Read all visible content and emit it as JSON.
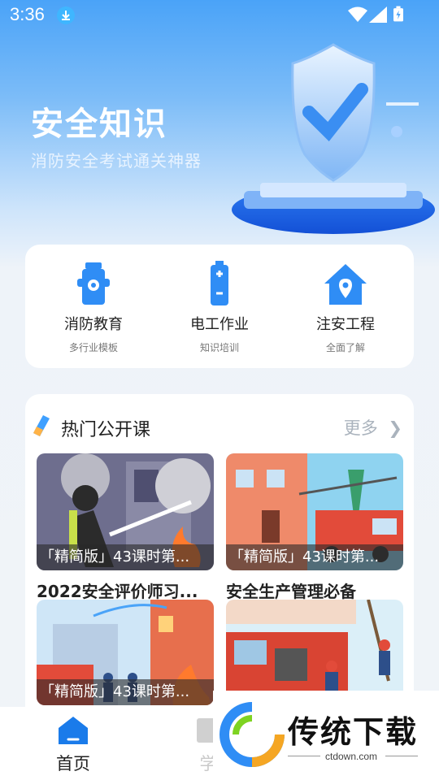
{
  "status_bar": {
    "time": "3:36"
  },
  "hero": {
    "title": "安全知识",
    "subtitle": "消防安全考试通关神器"
  },
  "quick_links": [
    {
      "label": "消防教育",
      "desc": "多行业模板",
      "icon": "fire-hydrant-icon"
    },
    {
      "label": "电工作业",
      "desc": "知识培训",
      "icon": "battery-icon"
    },
    {
      "label": "注安工程",
      "desc": "全面了解",
      "icon": "house-location-icon"
    }
  ],
  "courses_section": {
    "title": "热门公开课",
    "more": "更多"
  },
  "courses": [
    {
      "caption": "「精简版」43课时第...",
      "title": "2022安全评价师习..."
    },
    {
      "caption": "「精简版」43课时第...",
      "title": "安全生产管理必备"
    },
    {
      "caption": "「精简版」43课时第...",
      "title": ""
    },
    {
      "caption": "",
      "title": ""
    }
  ],
  "tabbar": {
    "home": "首页",
    "study": "学"
  },
  "watermark": {
    "brand": "传统下载",
    "url": "ctdown.com"
  },
  "colors": {
    "primary": "#2f8df5",
    "accent": "#1a7bea"
  }
}
